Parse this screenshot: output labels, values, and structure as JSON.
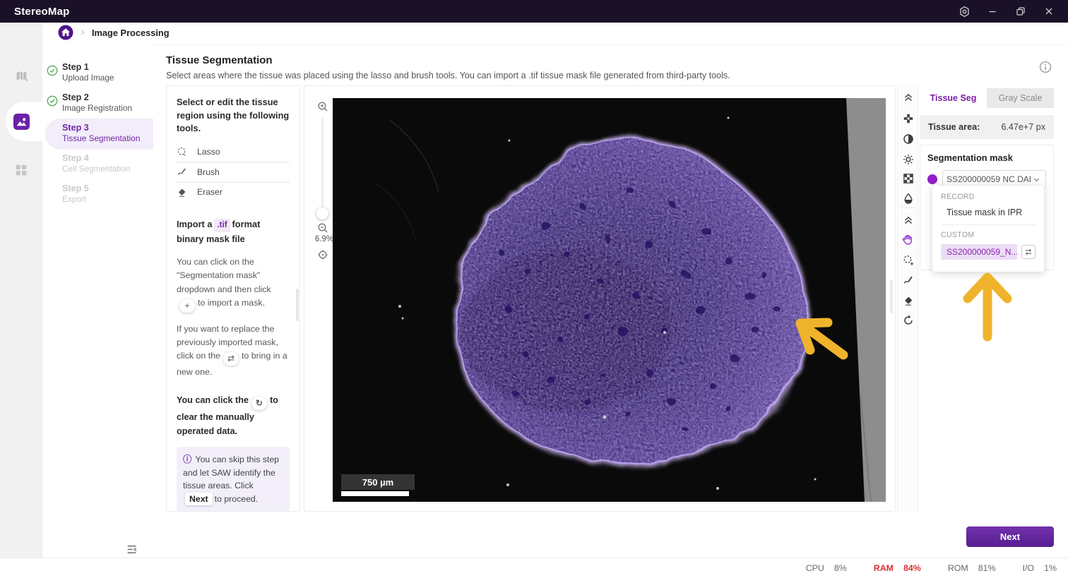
{
  "titlebar": {
    "app_name": "StereoMap",
    "window_icons": [
      "settings-icon",
      "minimize-icon",
      "restore-icon",
      "close-icon"
    ]
  },
  "nav_rail": {
    "items": [
      {
        "icon": "map-icon",
        "active": false
      },
      {
        "icon": "image-processing-icon",
        "active": true
      },
      {
        "icon": "apps-grid-icon",
        "active": false
      }
    ]
  },
  "breadcrumb": {
    "home_icon": "home-icon",
    "current": "Image Processing"
  },
  "steps": [
    {
      "step": "Step 1",
      "label": "Upload Image",
      "status": "done"
    },
    {
      "step": "Step 2",
      "label": "Image Registration",
      "status": "done"
    },
    {
      "step": "Step 3",
      "label": "Tissue Segmentation",
      "status": "active"
    },
    {
      "step": "Step 4",
      "label": "Cell Segmentation",
      "status": "disabled"
    },
    {
      "step": "Step 5",
      "label": "Export",
      "status": "disabled"
    }
  ],
  "header": {
    "title": "Tissue Segmentation",
    "subtitle": "Select areas where the tissue was placed using the lasso and brush tools. You can import a .tif tissue mask file generated from third-party tools.",
    "info_icon": "info-icon"
  },
  "tools_panel": {
    "intro": "Select or edit the tissue region using the following tools.",
    "tools": [
      {
        "icon": "lasso-icon",
        "label": "Lasso"
      },
      {
        "icon": "brush-icon",
        "label": "Brush"
      },
      {
        "icon": "eraser-icon",
        "label": "Eraser"
      }
    ],
    "import_heading": {
      "pre": "Import a",
      "badge": ".tif",
      "post": "format binary mask file"
    },
    "import_para": {
      "pre": "You can click on the \"Segmentation mask\" dropdown and then click",
      "icon": "+",
      "post": "to import a mask."
    },
    "replace_para": {
      "pre": "If you want to replace the previously imported mask, click on the",
      "icon": "⇄",
      "post": "to bring in a new one."
    },
    "clear_para": {
      "pre": "You can click the",
      "icon": "↻",
      "post": "to clear the manually operated data."
    },
    "tip": {
      "icon": "info-icon",
      "pre": "You can skip this step and let SAW identify the tissue areas. Click",
      "button": "Next",
      "post": "to proceed."
    }
  },
  "canvas": {
    "zoom_in_icon": "zoom-in-icon",
    "zoom_out_icon": "zoom-out-icon",
    "fit_view_icon": "fit-view-icon",
    "zoom_level": "6.9%",
    "scale_bar_label": "750 µm"
  },
  "right_toolbar": {
    "items": [
      "collapse-up-icon",
      "position-adjust-icon",
      "contrast-icon",
      "brightness-icon",
      "checkerboard-icon",
      "saturation-icon",
      "collapse-up-icon",
      "pan-hand-icon",
      "lasso-add-icon",
      "brush-icon",
      "eraser-icon",
      "reset-icon"
    ],
    "active_tool": "pan-hand-icon",
    "active_color": "#8a2bd0"
  },
  "right_panel": {
    "tabs": [
      {
        "label": "Tissue Seg",
        "active": true
      },
      {
        "label": "Gray Scale",
        "active": false
      }
    ],
    "tissue_area": {
      "label": "Tissue area:",
      "value": "6.47e+7 px"
    },
    "segmentation_mask": {
      "heading": "Segmentation mask",
      "swatch_color": "#941ec9",
      "selected": "SS200000059 NC DAI"
    },
    "dropdown": {
      "record_group": "RECORD",
      "record_item": "Tissue mask in IPR",
      "custom_group": "CUSTOM",
      "custom_item": "SS200000059_N...",
      "swap_icon": "swap-icon"
    }
  },
  "annotations": {
    "arrow_color": "#f0b32c"
  },
  "footer": {
    "next_label": "Next"
  },
  "statusbar": {
    "items": [
      {
        "label": "CPU",
        "value": "8%",
        "alert": false
      },
      {
        "label": "RAM",
        "value": "84%",
        "alert": true
      },
      {
        "label": "ROM",
        "value": "81%",
        "alert": false
      },
      {
        "label": "I/O",
        "value": "1%",
        "alert": false
      }
    ]
  }
}
